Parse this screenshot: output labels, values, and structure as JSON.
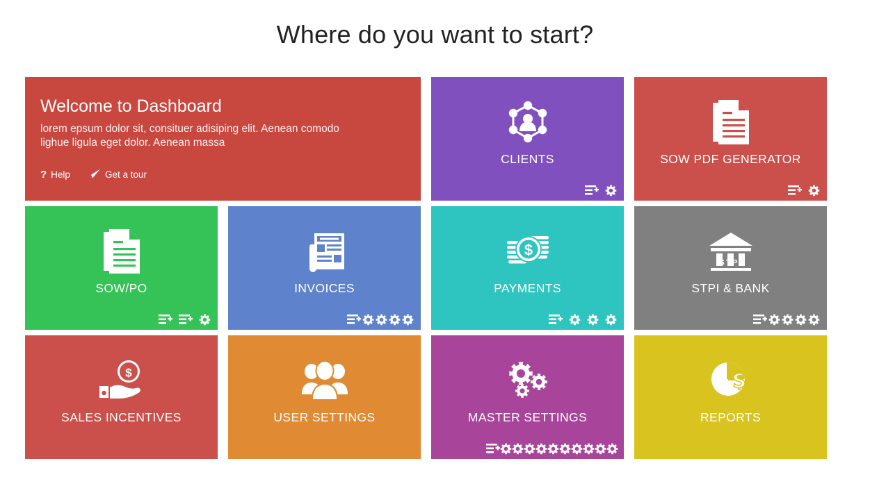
{
  "header": {
    "title": "Where do you want to start?"
  },
  "welcome": {
    "title": "Welcome to Dashboard",
    "body": "lorem epsum dolor sit, consituer adisiping elit. Aenean comodo lighue ligula eget dolor. Aenean massa",
    "help_label": "Help",
    "tour_label": "Get a tour",
    "color": "#c8473f"
  },
  "tiles": [
    {
      "id": "clients",
      "label": "CLIENTS",
      "color": "#8050be",
      "icon": "clients-network-icon",
      "actions": [
        "list-plus-icon",
        "gear-icon"
      ]
    },
    {
      "id": "sow-pdf-generator",
      "label": "SOW PDF GENERATOR",
      "color": "#cb4f4a",
      "icon": "document-icon",
      "actions": [
        "list-plus-icon",
        "gear-icon"
      ]
    },
    {
      "id": "sow-po",
      "label": "SOW/PO",
      "color": "#35c256",
      "icon": "document-icon",
      "actions": [
        "list-plus-icon",
        "list-plus-icon",
        "gear-icon"
      ]
    },
    {
      "id": "invoices",
      "label": "INVOICES",
      "color": "#5e83cc",
      "icon": "newspaper-icon",
      "actions": [
        "list-plus-icon",
        "gear-icon",
        "gear-icon",
        "gear-icon",
        "gear-icon"
      ]
    },
    {
      "id": "payments",
      "label": "PAYMENTS",
      "color": "#2ec5c0",
      "icon": "coins-dollar-icon",
      "actions": [
        "list-plus-icon",
        "gear-icon",
        "gear-icon",
        "gear-icon"
      ]
    },
    {
      "id": "stpi-bank",
      "label": "STPI & BANK",
      "color": "#808080",
      "icon": "bank-icon",
      "icon_text": "STPI",
      "actions": [
        "list-plus-icon",
        "gear-icon",
        "gear-icon",
        "gear-icon",
        "gear-icon"
      ]
    },
    {
      "id": "sales-incentives",
      "label": "SALES INCENTIVES",
      "color": "#cb4f4a",
      "icon": "hand-coin-icon",
      "actions": []
    },
    {
      "id": "user-settings",
      "label": "USER SETTINGS",
      "color": "#e08a33",
      "icon": "users-group-icon",
      "actions": []
    },
    {
      "id": "master-settings",
      "label": "MASTER SETTINGS",
      "color": "#a8459a",
      "icon": "gears-icon",
      "actions": [
        "list-plus-icon",
        "gear-icon",
        "gear-icon",
        "gear-icon",
        "gear-icon",
        "gear-icon",
        "gear-icon",
        "gear-icon",
        "gear-icon",
        "gear-icon",
        "gear-icon"
      ]
    },
    {
      "id": "reports",
      "label": "REPORTS",
      "color": "#d9c41f",
      "icon": "pie-chart-dollar-icon",
      "actions": []
    }
  ]
}
